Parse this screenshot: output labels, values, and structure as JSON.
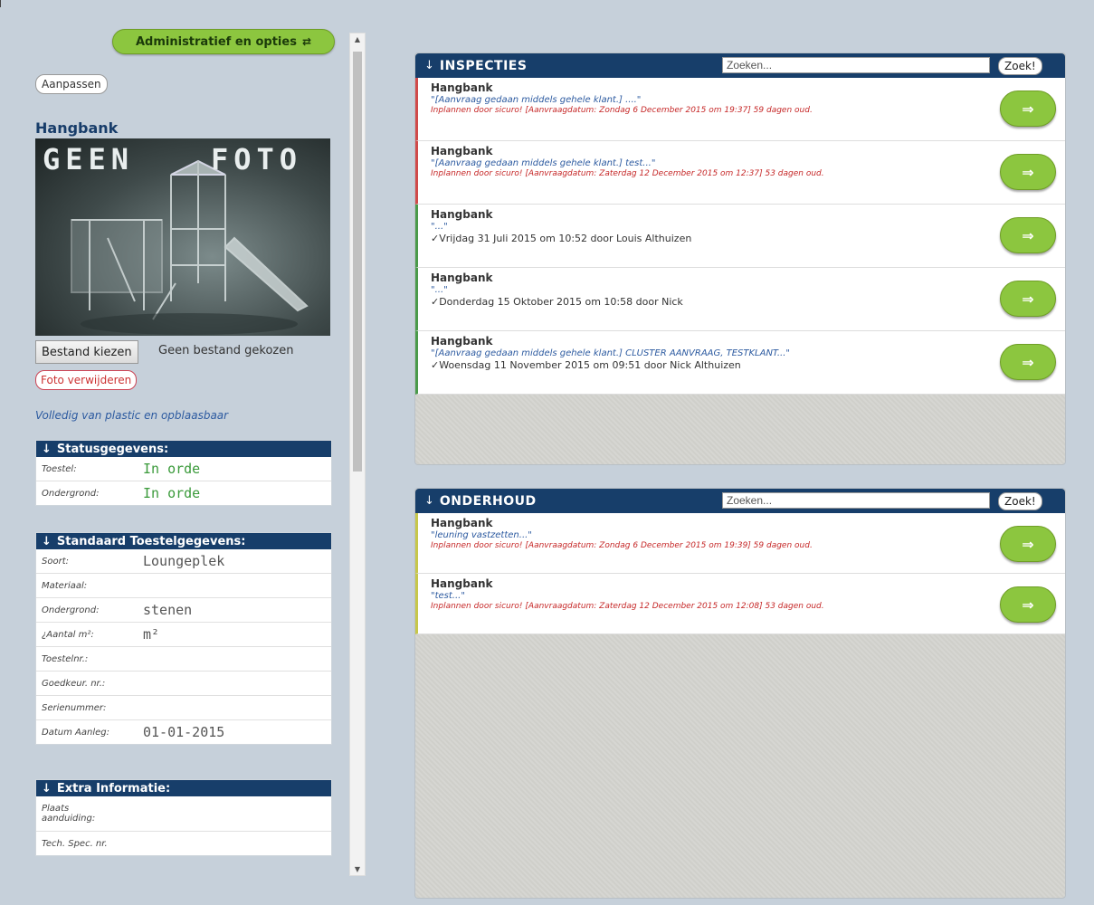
{
  "sidebar": {
    "admin_button": "Administratief en opties",
    "adjust_button": "Aanpassen",
    "device_title": "Hangbank",
    "photo": {
      "text_left": "GEEN",
      "text_right": "FOTO"
    },
    "file_button": "Bestand kiezen",
    "file_status": "Geen bestand gekozen",
    "remove_photo_button": "Foto verwijderen",
    "description": "Volledig van plastic en opblaasbaar",
    "status_panel": {
      "title": "Statusgegevens:",
      "rows": [
        {
          "label": "Toestel:",
          "value": "In orde"
        },
        {
          "label": "Ondergrond:",
          "value": "In orde"
        }
      ]
    },
    "standard_panel": {
      "title": "Standaard Toestelgegevens:",
      "rows": [
        {
          "label": "Soort:",
          "value": "Loungeplek"
        },
        {
          "label": "Materiaal:",
          "value": ""
        },
        {
          "label": "Ondergrond:",
          "value": "stenen"
        },
        {
          "label": "¿Aantal m²:",
          "value": "m²"
        },
        {
          "label": "Toestelnr.:",
          "value": ""
        },
        {
          "label": "Goedkeur. nr.:",
          "value": ""
        },
        {
          "label": "Serienummer:",
          "value": ""
        },
        {
          "label": "Datum Aanleg:",
          "value": "01-01-2015"
        }
      ]
    },
    "extra_panel": {
      "title": "Extra Informatie:",
      "rows": [
        {
          "label": "Plaats aanduiding:",
          "value": ""
        },
        {
          "label": "Tech. Spec. nr.",
          "value": ""
        }
      ]
    }
  },
  "inspecties": {
    "title": "INSPECTIES",
    "search_placeholder": "Zoeken...",
    "search_button": "Zoek!",
    "items": [
      {
        "name": "Hangbank",
        "quote": "\"[Aanvraag gedaan middels gehele klant.] ....\"",
        "status": "Inplannen door sicuro! [Aanvraagdatum: Zondag 6 December 2015 om 19:37] 59 dagen oud."
      },
      {
        "name": "Hangbank",
        "quote": "\"[Aanvraag gedaan middels gehele klant.] test...\"",
        "status": "Inplannen door sicuro! [Aanvraagdatum: Zaterdag 12 December 2015 om 12:37] 53 dagen oud."
      },
      {
        "name": "Hangbank",
        "quote": "\"...\"",
        "status": "✓Vrijdag 31 Juli 2015 om 10:52 door Louis Althuizen"
      },
      {
        "name": "Hangbank",
        "quote": "\"...\"",
        "status": "✓Donderdag 15 Oktober 2015 om 10:58 door Nick"
      },
      {
        "name": "Hangbank",
        "quote": "\"[Aanvraag gedaan middels gehele klant.] CLUSTER AANVRAAG, TESTKLANT...\"",
        "status": "✓Woensdag 11 November 2015 om 09:51 door Nick Althuizen"
      }
    ],
    "arrow": "⇒"
  },
  "onderhoud": {
    "title": "ONDERHOUD",
    "search_placeholder": "Zoeken...",
    "search_button": "Zoek!",
    "items": [
      {
        "name": "Hangbank",
        "quote": "\"leuning vastzetten...\"",
        "status": "Inplannen door sicuro! [Aanvraagdatum: Zondag 6 December 2015 om 19:39] 59 dagen oud."
      },
      {
        "name": "Hangbank",
        "quote": "\"test...\"",
        "status": "Inplannen door sicuro! [Aanvraagdatum: Zaterdag 12 December 2015 om 12:08] 53 dagen oud."
      }
    ],
    "arrow": "⇒"
  },
  "colors": {
    "navy": "#173e6a",
    "lime": "#8cc63f",
    "red_status": "#c62828",
    "blue_quote": "#2c5aa0"
  }
}
